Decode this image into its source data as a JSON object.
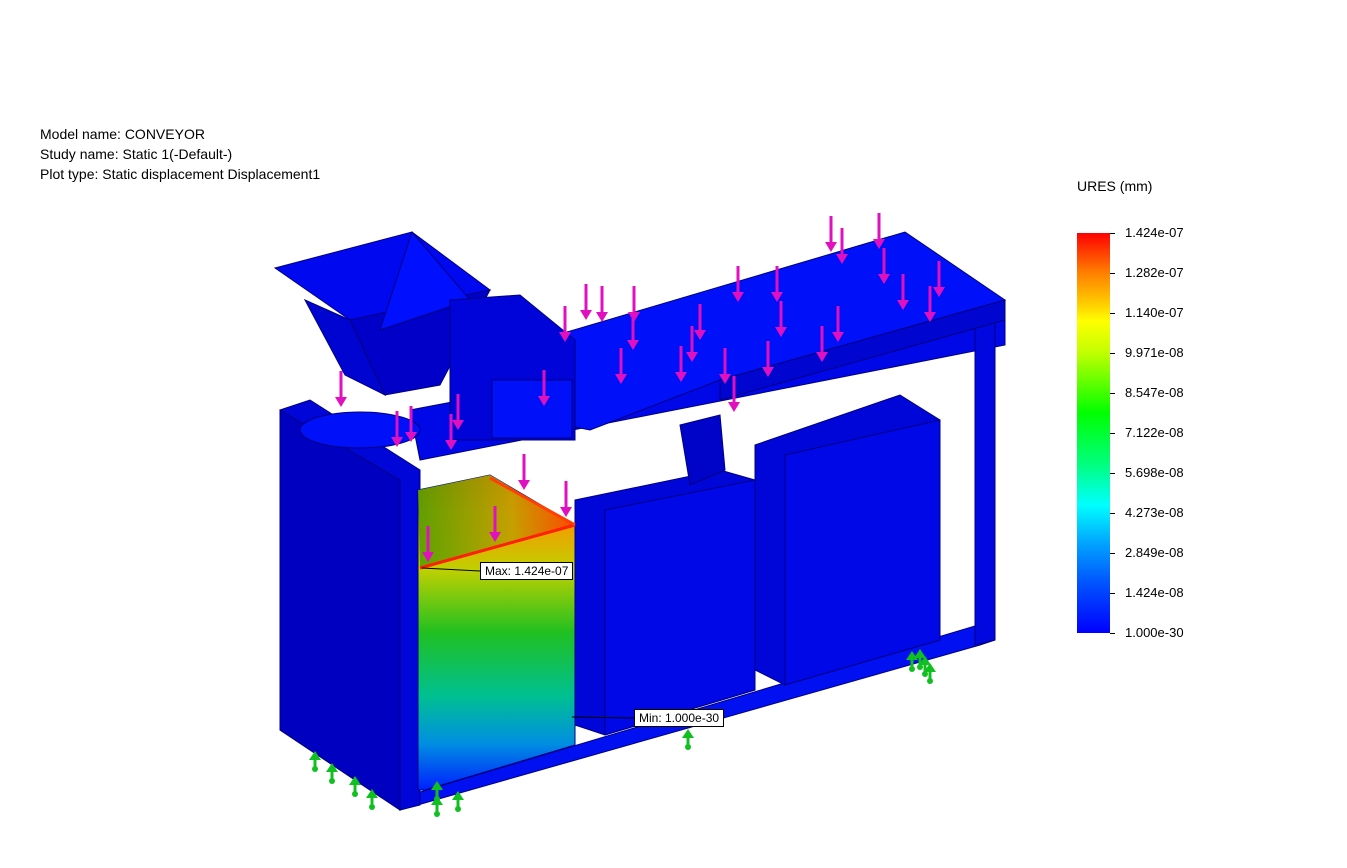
{
  "info": {
    "model_name": "Model name: CONVEYOR",
    "study_name": "Study name: Static 1(-Default-)",
    "plot_type": "Plot type: Static displacement Displacement1"
  },
  "legend": {
    "title": "URES (mm)",
    "labels": [
      "1.424e-07",
      "1.282e-07",
      "1.140e-07",
      "9.971e-08",
      "8.547e-08",
      "7.122e-08",
      "5.698e-08",
      "4.273e-08",
      "2.849e-08",
      "1.424e-08",
      "1.000e-30"
    ]
  },
  "callouts": {
    "max": "Max: 1.424e-07",
    "min": "Min: 1.000e-30"
  },
  "colors": {
    "model_blue": "#0000ff",
    "edge_dark": "#000080",
    "load_arrow": "#e010c0",
    "fixture": "#10c020"
  }
}
